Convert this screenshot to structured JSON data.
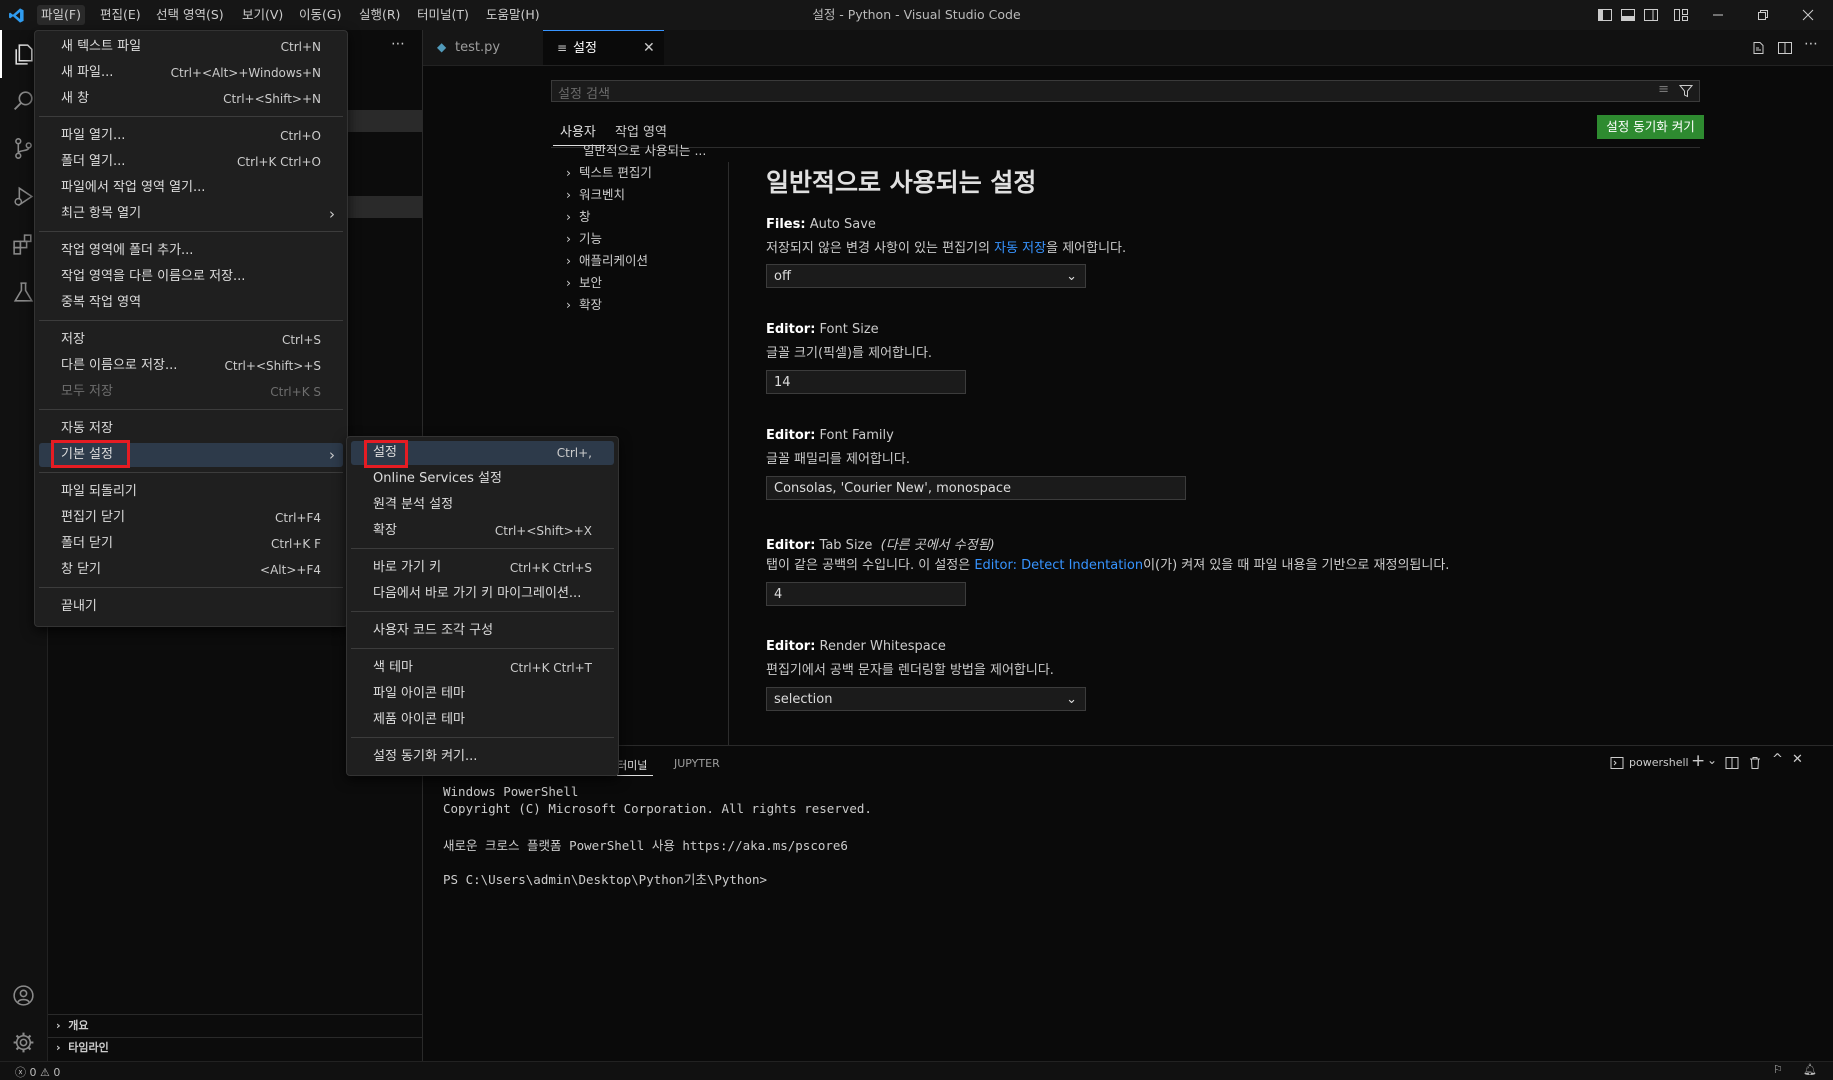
{
  "window": {
    "title": "설정 - Python - Visual Studio Code",
    "menubar": [
      "파일(F)",
      "편집(E)",
      "선택 영역(S)",
      "보기(V)",
      "이동(G)",
      "실행(R)",
      "터미널(T)",
      "도움말(H)"
    ]
  },
  "file_menu": {
    "items": [
      {
        "label": "새 텍스트 파일",
        "shortcut": "Ctrl+N"
      },
      {
        "label": "새 파일...",
        "shortcut": "Ctrl+<Alt>+Windows+N"
      },
      {
        "label": "새 창",
        "shortcut": "Ctrl+<Shift>+N"
      },
      {
        "label": "파일 열기...",
        "shortcut": "Ctrl+O"
      },
      {
        "label": "폴더 열기...",
        "shortcut": "Ctrl+K Ctrl+O"
      },
      {
        "label": "파일에서 작업 영역 열기...",
        "shortcut": ""
      },
      {
        "label": "최근 항목 열기",
        "shortcut": ""
      },
      {
        "label": "작업 영역에 폴더 추가...",
        "shortcut": ""
      },
      {
        "label": "작업 영역을 다른 이름으로 저장...",
        "shortcut": ""
      },
      {
        "label": "중복 작업 영역",
        "shortcut": ""
      },
      {
        "label": "저장",
        "shortcut": "Ctrl+S"
      },
      {
        "label": "다른 이름으로 저장...",
        "shortcut": "Ctrl+<Shift>+S"
      },
      {
        "label": "모두 저장",
        "shortcut": "Ctrl+K S"
      },
      {
        "label": "자동 저장",
        "shortcut": ""
      },
      {
        "label": "기본 설정",
        "shortcut": ""
      },
      {
        "label": "파일 되돌리기",
        "shortcut": ""
      },
      {
        "label": "편집기 닫기",
        "shortcut": "Ctrl+F4"
      },
      {
        "label": "폴더 닫기",
        "shortcut": "Ctrl+K F"
      },
      {
        "label": "창 닫기",
        "shortcut": "<Alt>+F4"
      },
      {
        "label": "끝내기",
        "shortcut": ""
      }
    ]
  },
  "prefs_submenu": {
    "items": [
      {
        "label": "설정",
        "shortcut": "Ctrl+,"
      },
      {
        "label": "Online Services 설정",
        "shortcut": ""
      },
      {
        "label": "원격 분석 설정",
        "shortcut": ""
      },
      {
        "label": "확장",
        "shortcut": "Ctrl+<Shift>+X"
      },
      {
        "label": "바로 가기 키",
        "shortcut": "Ctrl+K Ctrl+S"
      },
      {
        "label": "다음에서 바로 가기 키 마이그레이션...",
        "shortcut": ""
      },
      {
        "label": "사용자 코드 조각 구성",
        "shortcut": ""
      },
      {
        "label": "색 테마",
        "shortcut": "Ctrl+K Ctrl+T"
      },
      {
        "label": "파일 아이콘 테마",
        "shortcut": ""
      },
      {
        "label": "제품 아이콘 테마",
        "shortcut": ""
      },
      {
        "label": "설정 동기화 켜기...",
        "shortcut": ""
      }
    ]
  },
  "tabs": [
    {
      "label": "test.py"
    },
    {
      "label": "설정"
    }
  ],
  "settings": {
    "search_placeholder": "설정 검색",
    "scope_tabs": [
      "사용자",
      "작업 영역"
    ],
    "sync_button": "설정 동기화 켜기",
    "toc": [
      "일반적으로 사용되는 ...",
      "텍스트 편집기",
      "워크벤치",
      "창",
      "기능",
      "애플리케이션",
      "보안",
      "확장"
    ],
    "heading": "일반적으로 사용되는 설정",
    "entries": [
      {
        "category": "Files:",
        "name": "Auto Save",
        "desc_pre": "저장되지 않은 변경 사항이 있는 편집기의 ",
        "desc_link": "자동 저장",
        "desc_post": "을 제어합니다.",
        "value": "off"
      },
      {
        "category": "Editor:",
        "name": "Font Size",
        "desc": "글꼴 크기(픽셀)를 제어합니다.",
        "value": "14"
      },
      {
        "category": "Editor:",
        "name": "Font Family",
        "desc": "글꼴 패밀리를 제어합니다.",
        "value": "Consolas, 'Courier New', monospace"
      },
      {
        "category": "Editor:",
        "name": "Tab Size",
        "modified": "(다른 곳에서 수정됨)",
        "desc_pre": "탭이 같은 공백의 수입니다. 이 설정은 ",
        "desc_link": "Editor: Detect Indentation",
        "desc_post": "이(가) 켜져 있을 때 파일 내용을 기반으로 재정의됩니다.",
        "value": "4"
      },
      {
        "category": "Editor:",
        "name": "Render Whitespace",
        "desc": "편집기에서 공백 문자를 렌더링할 방법을 제어합니다.",
        "value": "selection"
      }
    ]
  },
  "panel": {
    "tabs": [
      "터미널",
      "JUPYTER"
    ],
    "shell": "powershell",
    "lines": [
      "Windows PowerShell",
      "Copyright (C) Microsoft Corporation. All rights reserved.",
      "",
      "새로운 크로스 플랫폼 PowerShell 사용 https://aka.ms/pscore6",
      "",
      "PS C:\\Users\\admin\\Desktop\\Python기초\\Python>"
    ]
  },
  "sidebar": {
    "sections": [
      "개요",
      "타임라인"
    ]
  },
  "statusbar": {
    "errors": "0",
    "warnings": "0"
  },
  "colors": {
    "accent_blue": "#3794ff",
    "sync_button": "#2e8b30",
    "highlight_box": "#e51c23"
  }
}
